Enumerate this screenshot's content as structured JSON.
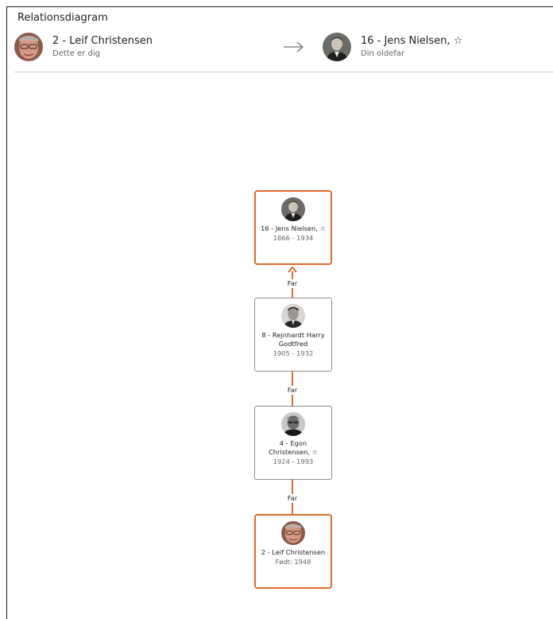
{
  "header": {
    "title": "Relationsdiagram",
    "from": {
      "name": "2 - Leif Christensen",
      "subtitle": "Dette er dig"
    },
    "to": {
      "name": "16 - Jens Nielsen, ☆",
      "subtitle": "Din oldefar"
    }
  },
  "colors": {
    "accent": "#e06b2d",
    "card_border": "#8c8c8c"
  },
  "chain": [
    {
      "name": "16 - Jens Nielsen, ☆",
      "years": "1866 - 1934",
      "highlighted": true,
      "avatar": "jens-nielsen-photo"
    },
    {
      "name": "8 - Rejnhardt Harry Godtfred",
      "years": "1905 - 1932",
      "highlighted": false,
      "avatar": "rejnhardt-photo"
    },
    {
      "name": "4 - Egon Christensen, ☆",
      "years": "1924 - 1993",
      "highlighted": false,
      "avatar": "egon-photo"
    },
    {
      "name": "2 - Leif Christensen",
      "years": "Født: 1948",
      "highlighted": true,
      "avatar": "leif-photo"
    }
  ],
  "relations": [
    "Far",
    "Far",
    "Far"
  ]
}
